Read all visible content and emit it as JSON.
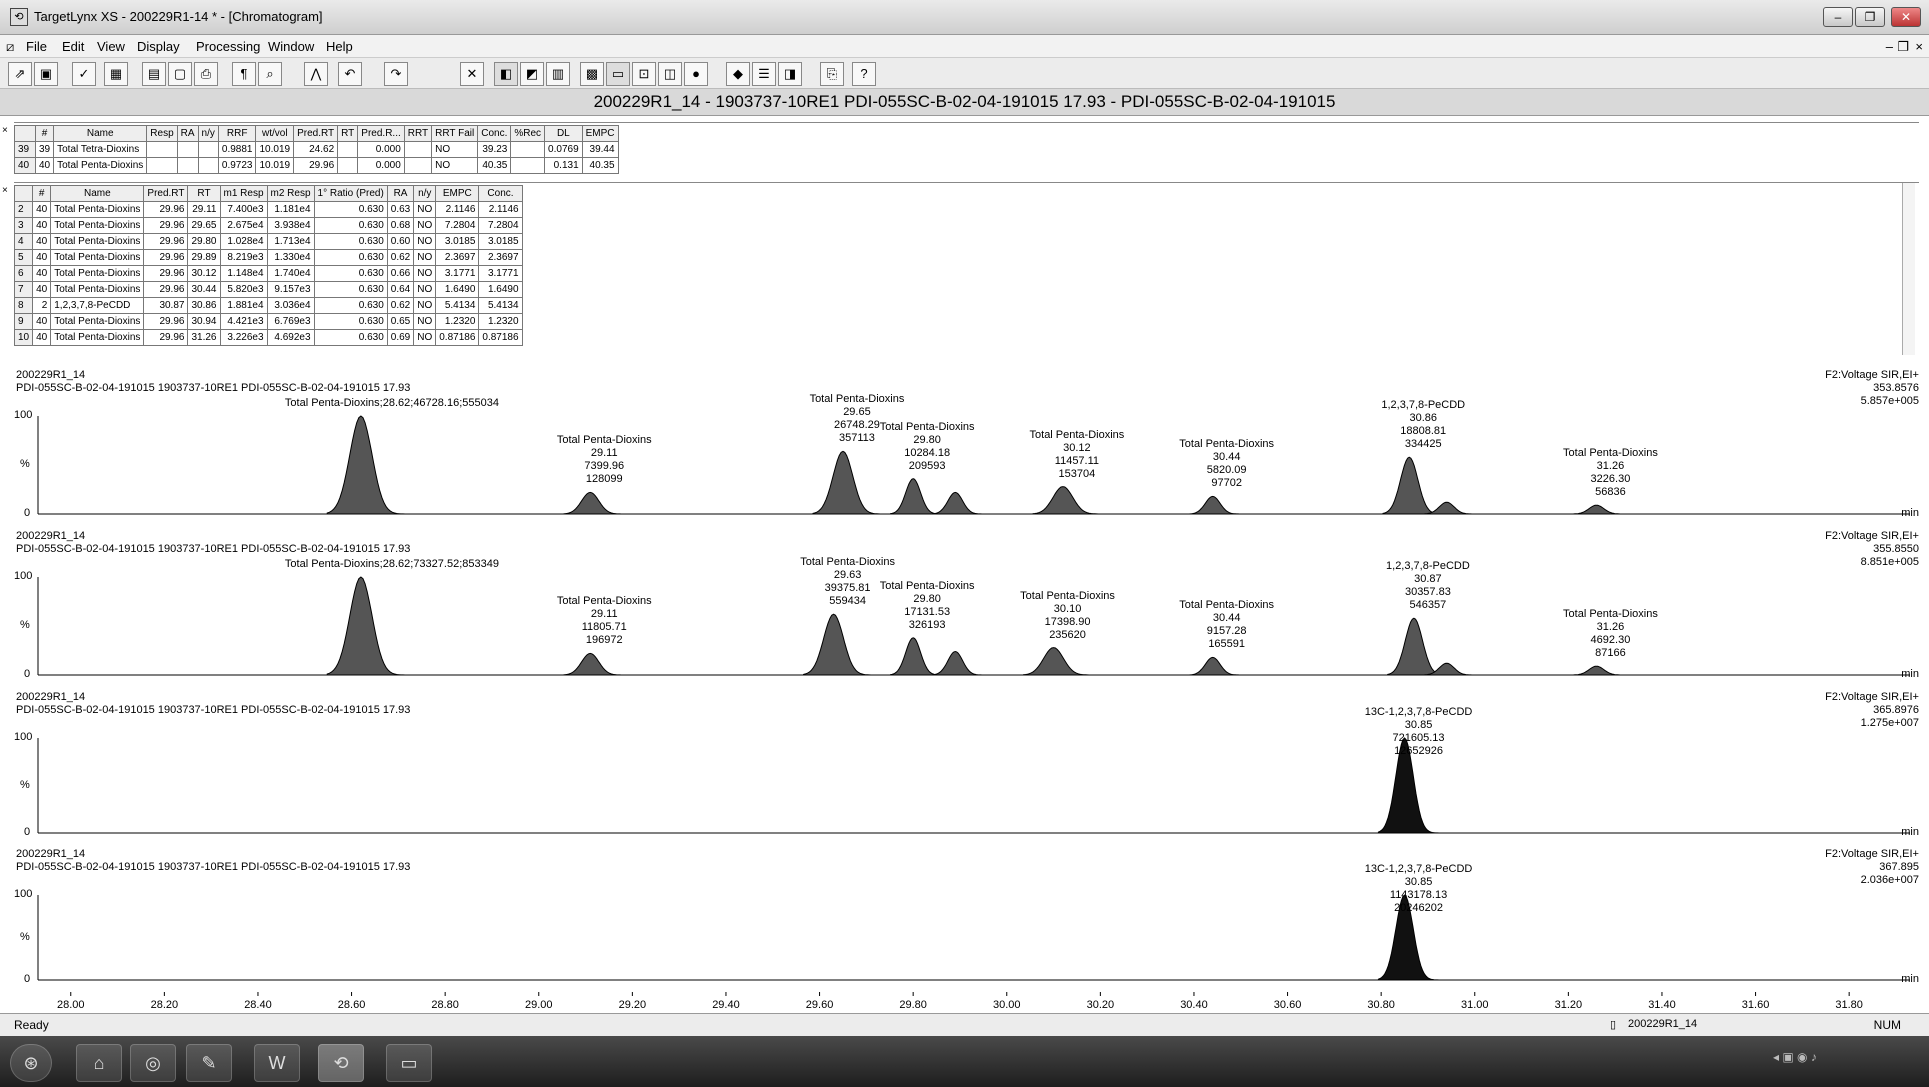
{
  "window": {
    "title": "TargetLynx XS - 200229R1-14 * - [Chromatogram]",
    "controls": {
      "minimize": "–",
      "restore": "❐",
      "close": "✕"
    }
  },
  "menu": [
    "File",
    "Edit",
    "View",
    "Display",
    "Processing",
    "Window",
    "Help"
  ],
  "toolbar_icons": [
    "open-icon",
    "save-icon",
    "check-icon",
    "chart-icon",
    "table-icon",
    "report-icon",
    "print-icon",
    "arrow-icon",
    "zoom-icon",
    "peak-icon",
    "undo-icon",
    "redo-icon",
    "cross-icon",
    "view-icon",
    "grid-icon",
    "layout-icon",
    "help-icon"
  ],
  "header": {
    "sample_line": "200229R1_14 - 1903737-10RE1 PDI-055SC-B-02-04-191015 17.93 - PDI-055SC-B-02-04-191015"
  },
  "summary_table": {
    "columns": [
      "#",
      "Name",
      "Resp",
      "RA",
      "n/y",
      "RRF",
      "wt/vol",
      "Pred.RT",
      "RT",
      "Pred.R...",
      "RRT",
      "RRT Fail",
      "Conc.",
      "%Rec",
      "DL",
      "EMPC"
    ],
    "rows": [
      {
        "row": "39",
        "cells": [
          "39",
          "Total Tetra-Dioxins",
          "",
          "",
          "",
          "0.9881",
          "10.019",
          "24.62",
          "",
          "0.000",
          "",
          "NO",
          "39.23",
          "",
          "0.0769",
          "39.44"
        ]
      },
      {
        "row": "40",
        "cells": [
          "40",
          "Total Penta-Dioxins",
          "",
          "",
          "",
          "0.9723",
          "10.019",
          "29.96",
          "",
          "0.000",
          "",
          "NO",
          "40.35",
          "",
          "0.131",
          "40.35"
        ]
      }
    ]
  },
  "peak_table": {
    "columns": [
      "#",
      "Name",
      "Pred.RT",
      "RT",
      "m1 Resp",
      "m2 Resp",
      "1° Ratio (Pred)",
      "RA",
      "n/y",
      "EMPC",
      "Conc."
    ],
    "rows": [
      {
        "row": "2",
        "cells": [
          "40",
          "Total Penta-Dioxins",
          "29.96",
          "29.11",
          "7.400e3",
          "1.181e4",
          "0.630",
          "0.63",
          "NO",
          "2.1146",
          "2.1146"
        ]
      },
      {
        "row": "3",
        "cells": [
          "40",
          "Total Penta-Dioxins",
          "29.96",
          "29.65",
          "2.675e4",
          "3.938e4",
          "0.630",
          "0.68",
          "NO",
          "7.2804",
          "7.2804"
        ]
      },
      {
        "row": "4",
        "cells": [
          "40",
          "Total Penta-Dioxins",
          "29.96",
          "29.80",
          "1.028e4",
          "1.713e4",
          "0.630",
          "0.60",
          "NO",
          "3.0185",
          "3.0185"
        ]
      },
      {
        "row": "5",
        "cells": [
          "40",
          "Total Penta-Dioxins",
          "29.96",
          "29.89",
          "8.219e3",
          "1.330e4",
          "0.630",
          "0.62",
          "NO",
          "2.3697",
          "2.3697"
        ]
      },
      {
        "row": "6",
        "cells": [
          "40",
          "Total Penta-Dioxins",
          "29.96",
          "30.12",
          "1.148e4",
          "1.740e4",
          "0.630",
          "0.66",
          "NO",
          "3.1771",
          "3.1771"
        ]
      },
      {
        "row": "7",
        "cells": [
          "40",
          "Total Penta-Dioxins",
          "29.96",
          "30.44",
          "5.820e3",
          "9.157e3",
          "0.630",
          "0.64",
          "NO",
          "1.6490",
          "1.6490"
        ]
      },
      {
        "row": "8",
        "cells": [
          "2",
          "1,2,3,7,8-PeCDD",
          "30.87",
          "30.86",
          "1.881e4",
          "3.036e4",
          "0.630",
          "0.62",
          "NO",
          "5.4134",
          "5.4134"
        ]
      },
      {
        "row": "9",
        "cells": [
          "40",
          "Total Penta-Dioxins",
          "29.96",
          "30.94",
          "4.421e3",
          "6.769e3",
          "0.630",
          "0.65",
          "NO",
          "1.2320",
          "1.2320"
        ]
      },
      {
        "row": "10",
        "cells": [
          "40",
          "Total Penta-Dioxins",
          "29.96",
          "31.26",
          "3.226e3",
          "4.692e3",
          "0.630",
          "0.69",
          "NO",
          "0.87186",
          "0.87186"
        ]
      }
    ]
  },
  "chart_data": {
    "type": "line",
    "x_range": [
      27.93,
      31.93
    ],
    "x_ticks": [
      "28.00",
      "28.20",
      "28.40",
      "28.60",
      "28.80",
      "29.00",
      "29.20",
      "29.40",
      "29.60",
      "29.80",
      "30.00",
      "30.20",
      "30.40",
      "30.60",
      "30.80",
      "31.00",
      "31.20",
      "31.40",
      "31.60",
      "31.80"
    ],
    "x_unit": "min",
    "traces": [
      {
        "name": "200229R1_14",
        "description": "PDI-055SC-B-02-04-191015 1903737-10RE1 PDI-055SC-B-02-04-191015 17.93",
        "function": "F2:Voltage SIR,EI+",
        "mass": "353.8576",
        "intensity": "5.857e+005",
        "peaks": [
          {
            "rt": 28.62,
            "height": 100,
            "width": 0.045,
            "label": [
              "Total Penta-Dioxins;28.62;46728.16;555034"
            ]
          },
          {
            "rt": 29.11,
            "height": 22,
            "width": 0.035,
            "label": [
              "Total Penta-Dioxins",
              "29.11",
              "7399.96",
              "128099"
            ]
          },
          {
            "rt": 29.65,
            "height": 64,
            "width": 0.04,
            "label": [
              "Total Penta-Dioxins",
              "29.65",
              "26748.29",
              "357113"
            ]
          },
          {
            "rt": 29.8,
            "height": 36,
            "width": 0.03,
            "label": [
              "Total Penta-Dioxins",
              "29.80",
              "10284.18",
              "209593"
            ]
          },
          {
            "rt": 29.89,
            "height": 22,
            "width": 0.03,
            "label": []
          },
          {
            "rt": 30.12,
            "height": 28,
            "width": 0.04,
            "label": [
              "Total Penta-Dioxins",
              "30.12",
              "11457.11",
              "153704"
            ]
          },
          {
            "rt": 30.44,
            "height": 18,
            "width": 0.03,
            "label": [
              "Total Penta-Dioxins",
              "30.44",
              "5820.09",
              "97702"
            ]
          },
          {
            "rt": 30.86,
            "height": 58,
            "width": 0.035,
            "label": [
              "1,2,3,7,8-PeCDD",
              "30.86",
              "18808.81",
              "334425"
            ]
          },
          {
            "rt": 30.94,
            "height": 12,
            "width": 0.03,
            "label": []
          },
          {
            "rt": 31.26,
            "height": 9,
            "width": 0.03,
            "label": [
              "Total Penta-Dioxins",
              "31.26",
              "3226.30",
              "56836"
            ]
          }
        ]
      },
      {
        "name": "200229R1_14",
        "description": "PDI-055SC-B-02-04-191015 1903737-10RE1 PDI-055SC-B-02-04-191015 17.93",
        "function": "F2:Voltage SIR,EI+",
        "mass": "355.8550",
        "intensity": "8.851e+005",
        "peaks": [
          {
            "rt": 28.62,
            "height": 100,
            "width": 0.045,
            "label": [
              "Total Penta-Dioxins;28.62;73327.52;853349"
            ]
          },
          {
            "rt": 29.11,
            "height": 22,
            "width": 0.035,
            "label": [
              "Total Penta-Dioxins",
              "29.11",
              "11805.71",
              "196972"
            ]
          },
          {
            "rt": 29.63,
            "height": 62,
            "width": 0.04,
            "label": [
              "Total Penta-Dioxins",
              "29.63",
              "39375.81",
              "559434"
            ]
          },
          {
            "rt": 29.8,
            "height": 38,
            "width": 0.03,
            "label": [
              "Total Penta-Dioxins",
              "29.80",
              "17131.53",
              "326193"
            ]
          },
          {
            "rt": 29.89,
            "height": 24,
            "width": 0.03,
            "label": []
          },
          {
            "rt": 30.1,
            "height": 28,
            "width": 0.04,
            "label": [
              "Total Penta-Dioxins",
              "30.10",
              "17398.90",
              "235620"
            ]
          },
          {
            "rt": 30.44,
            "height": 18,
            "width": 0.03,
            "label": [
              "Total Penta-Dioxins",
              "30.44",
              "9157.28",
              "165591"
            ]
          },
          {
            "rt": 30.87,
            "height": 58,
            "width": 0.035,
            "label": [
              "1,2,3,7,8-PeCDD",
              "30.87",
              "30357.83",
              "546357"
            ]
          },
          {
            "rt": 30.94,
            "height": 12,
            "width": 0.03,
            "label": []
          },
          {
            "rt": 31.26,
            "height": 9,
            "width": 0.03,
            "label": [
              "Total Penta-Dioxins",
              "31.26",
              "4692.30",
              "87166"
            ]
          }
        ]
      },
      {
        "name": "200229R1_14",
        "description": "PDI-055SC-B-02-04-191015 1903737-10RE1 PDI-055SC-B-02-04-191015 17.93",
        "function": "F2:Voltage SIR,EI+",
        "mass": "365.8976",
        "intensity": "1.275e+007",
        "peaks": [
          {
            "rt": 30.85,
            "height": 100,
            "width": 0.035,
            "label": [
              "13C-1,2,3,7,8-PeCDD",
              "30.85",
              "721605.13",
              "12652926"
            ]
          }
        ]
      },
      {
        "name": "200229R1_14",
        "description": "PDI-055SC-B-02-04-191015 1903737-10RE1 PDI-055SC-B-02-04-191015 17.93",
        "function": "F2:Voltage SIR,EI+",
        "mass": "367.895",
        "intensity": "2.036e+007",
        "peaks": [
          {
            "rt": 30.85,
            "height": 100,
            "width": 0.035,
            "label": [
              "13C-1,2,3,7,8-PeCDD",
              "30.85",
              "1143178.13",
              "20246202"
            ]
          }
        ]
      }
    ],
    "y_ticks": [
      "100",
      "%",
      "0"
    ]
  },
  "status": {
    "left": "Ready",
    "doc": "200229R1_14",
    "right": "NUM"
  },
  "taskbar_icons": [
    "start-orb-icon",
    "explorer-icon",
    "media-icon",
    "app-icon",
    "word-icon",
    "targetlynx-icon",
    "folder-icon"
  ]
}
